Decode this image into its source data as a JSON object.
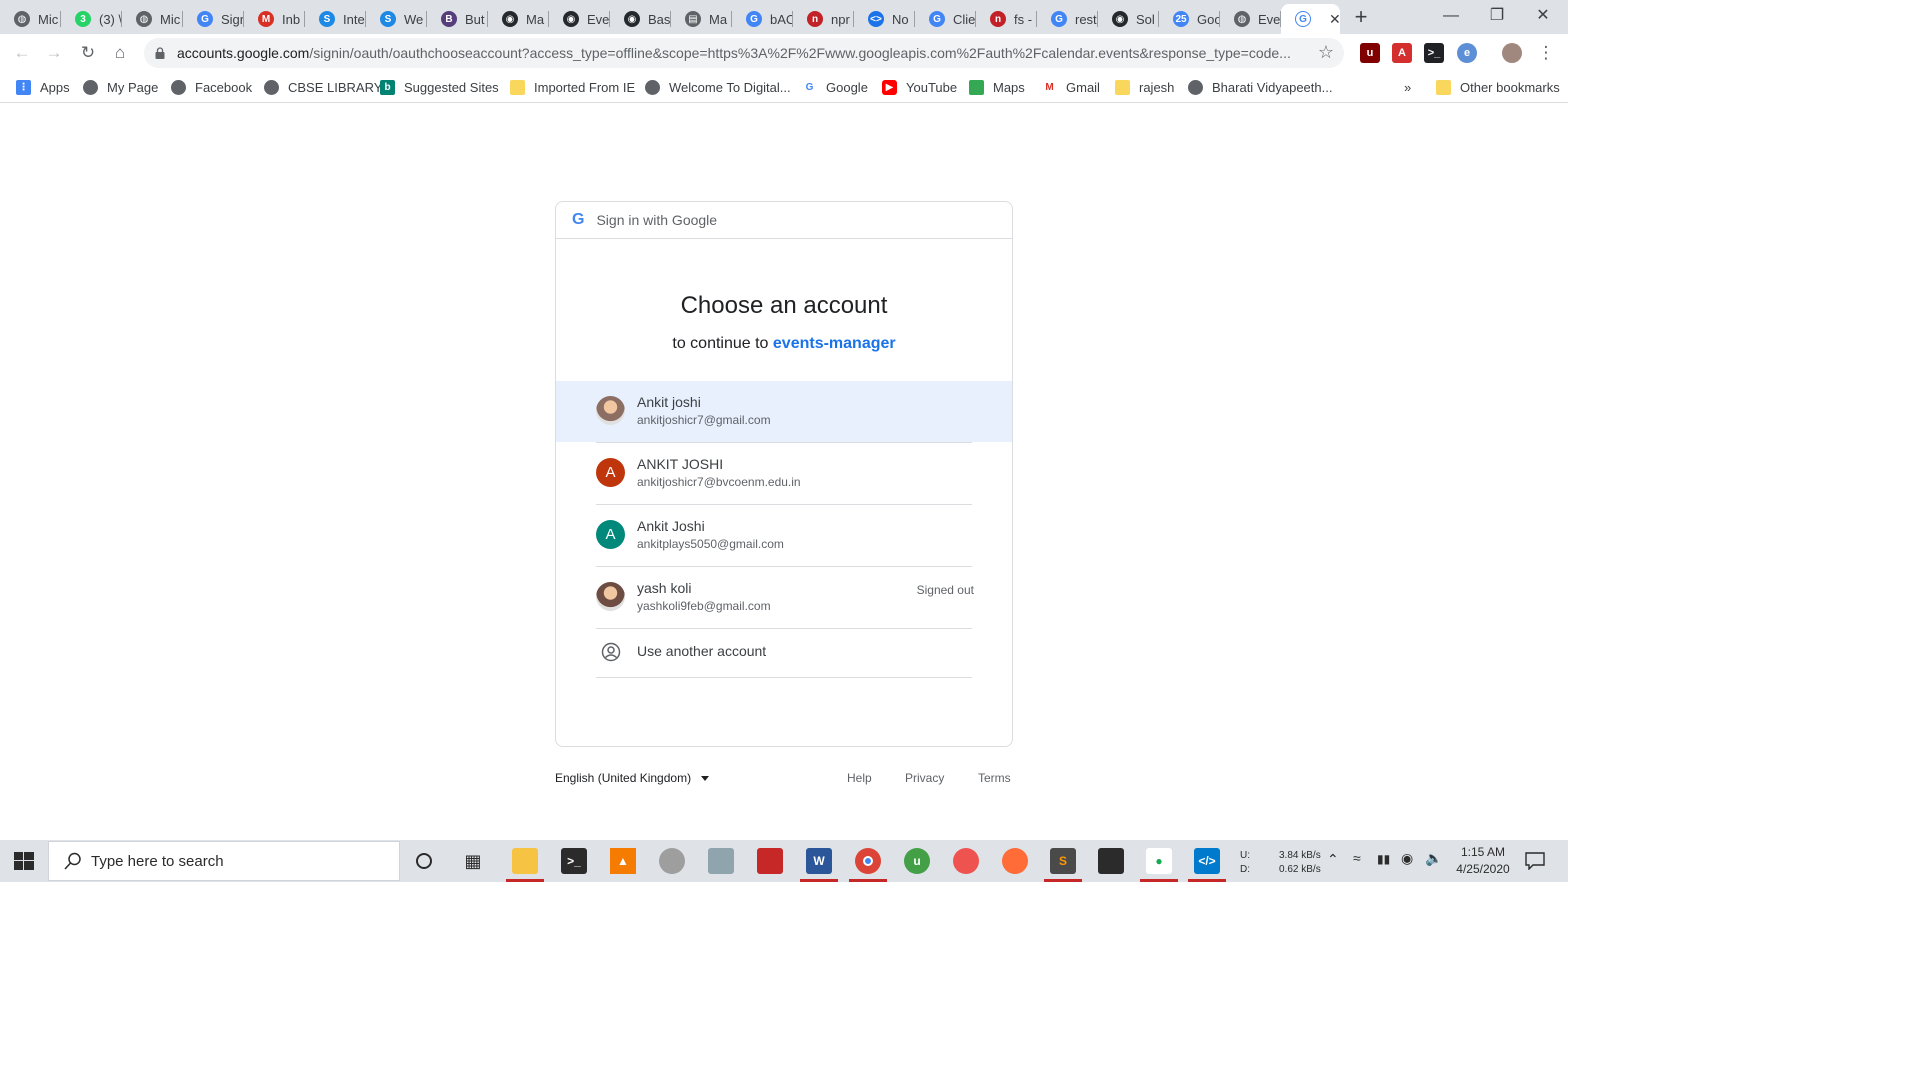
{
  "browser": {
    "tabs": [
      {
        "label": "Mic",
        "icon": "globe-icon",
        "color": "#5f6368"
      },
      {
        "label": "(3) \\",
        "icon": "whatsapp-icon",
        "color": "#25d366"
      },
      {
        "label": "Mic",
        "icon": "globe-icon",
        "color": "#5f6368"
      },
      {
        "label": "Sigr",
        "icon": "google-icon",
        "color": "#4285f4"
      },
      {
        "label": "Inb",
        "icon": "gmail-icon",
        "color": "#d93025"
      },
      {
        "label": "Inte",
        "icon": "s-icon",
        "color": "#1e88e5"
      },
      {
        "label": "We",
        "icon": "s-icon",
        "color": "#1e88e5"
      },
      {
        "label": "But",
        "icon": "bootstrap-icon",
        "color": "#563d7c"
      },
      {
        "label": "Ma",
        "icon": "github-icon",
        "color": "#24292e"
      },
      {
        "label": "Eve",
        "icon": "github-icon",
        "color": "#24292e"
      },
      {
        "label": "Bas",
        "icon": "github-icon",
        "color": "#24292e"
      },
      {
        "label": "Ma",
        "icon": "document-icon",
        "color": "#5f6368"
      },
      {
        "label": "bAC",
        "icon": "google-icon",
        "color": "#4285f4"
      },
      {
        "label": "npr",
        "icon": "npm-icon",
        "color": "#c12127"
      },
      {
        "label": "No",
        "icon": "code-icon",
        "color": "#1a73e8"
      },
      {
        "label": "Clie",
        "icon": "google-icon",
        "color": "#4285f4"
      },
      {
        "label": "fs -",
        "icon": "npm-icon",
        "color": "#c12127"
      },
      {
        "label": "rest",
        "icon": "google-icon",
        "color": "#4285f4"
      },
      {
        "label": "Sol",
        "icon": "github-icon",
        "color": "#24292e"
      },
      {
        "label": "Goo",
        "icon": "calendar-icon",
        "color": "#4285f4"
      },
      {
        "label": "Eve",
        "icon": "globe-icon",
        "color": "#5f6368"
      }
    ],
    "active_tab": {
      "icon": "google-icon",
      "close": "✕"
    },
    "url_host": "accounts.google.com",
    "url_path": "/signin/oauth/oauthchooseaccount?access_type=offline&scope=https%3A%2F%2Fwww.googleapis.com%2Fauth%2Fcalendar.events&response_type=code...",
    "bookmarks": [
      {
        "label": "Apps",
        "icon": "apps-grid-icon"
      },
      {
        "label": "My Page",
        "icon": "globe-icon"
      },
      {
        "label": "Facebook",
        "icon": "globe-icon"
      },
      {
        "label": "CBSE LIBRARY",
        "icon": "globe-icon"
      },
      {
        "label": "Suggested Sites",
        "icon": "bing-icon"
      },
      {
        "label": "Imported From IE",
        "icon": "folder-icon"
      },
      {
        "label": "Welcome To Digital...",
        "icon": "globe-icon"
      },
      {
        "label": "Google",
        "icon": "google-icon"
      },
      {
        "label": "YouTube",
        "icon": "youtube-icon"
      },
      {
        "label": "Maps",
        "icon": "maps-icon"
      },
      {
        "label": "Gmail",
        "icon": "gmail-icon"
      },
      {
        "label": "rajesh",
        "icon": "folder-icon"
      },
      {
        "label": "Bharati Vidyapeeth...",
        "icon": "globe-icon"
      }
    ],
    "bookmarks_overflow": "»",
    "other_bookmarks": "Other bookmarks"
  },
  "signin": {
    "header": "Sign in with Google",
    "heading": "Choose an account",
    "subtitle_prefix": "to continue to",
    "app_name": "events-manager",
    "accounts": [
      {
        "name": "Ankit joshi",
        "email": "ankitjoshicr7@gmail.com",
        "avatar": "photo",
        "avatar_color": "#8d6e63",
        "initial": "",
        "status": "",
        "selected": true
      },
      {
        "name": "ANKIT JOSHI",
        "email": "ankitjoshicr7@bvcoenm.edu.in",
        "avatar": "letter",
        "avatar_color": "#bf360c",
        "initial": "A",
        "status": "",
        "selected": false
      },
      {
        "name": "Ankit Joshi",
        "email": "ankitplays5050@gmail.com",
        "avatar": "letter",
        "avatar_color": "#00897b",
        "initial": "A",
        "status": "",
        "selected": false
      },
      {
        "name": "yash koli",
        "email": "yashkoli9feb@gmail.com",
        "avatar": "photo",
        "avatar_color": "#6d4c41",
        "initial": "",
        "status": "Signed out",
        "selected": false
      }
    ],
    "use_another": "Use another account"
  },
  "footer": {
    "language": "English (United Kingdom)",
    "help": "Help",
    "privacy": "Privacy",
    "terms": "Terms"
  },
  "taskbar": {
    "search_placeholder": "Type here to search",
    "network_up_label": "U:",
    "network_down_label": "D:",
    "network_up": "3.84 kB/s",
    "network_down": "0.62 kB/s",
    "time": "1:15 AM",
    "date": "4/25/2020"
  },
  "colors": {
    "accent": "#1a73e8",
    "selected_row": "#e8f0fe"
  }
}
